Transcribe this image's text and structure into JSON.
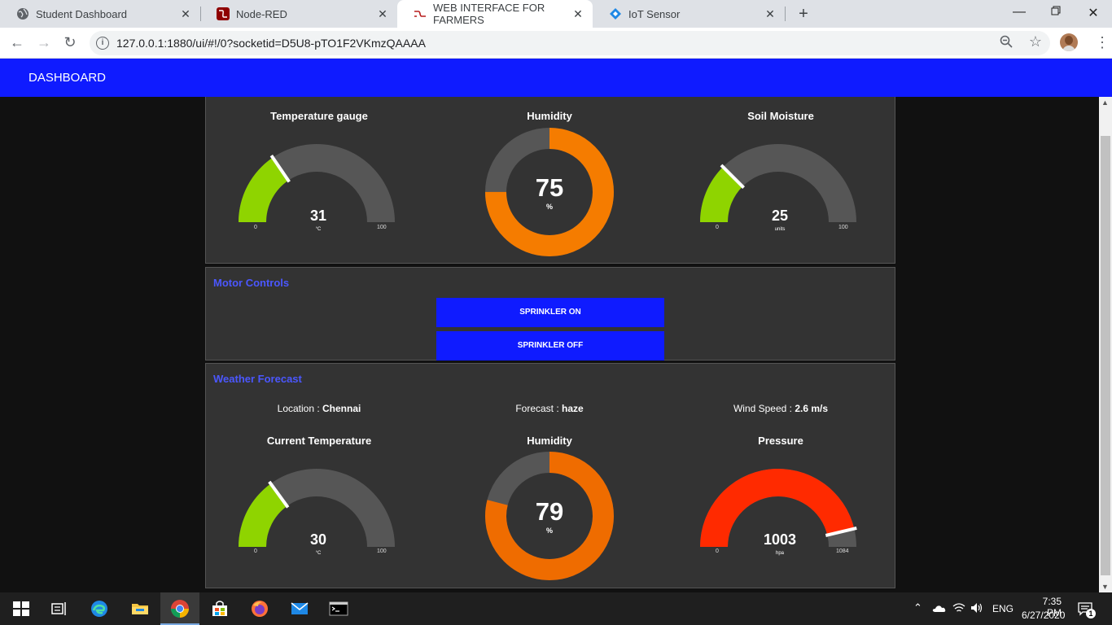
{
  "browser": {
    "tabs": [
      {
        "title": "Student Dashboard",
        "icon": "globe-icon"
      },
      {
        "title": "Node-RED",
        "icon": "node-red-icon"
      },
      {
        "title": "WEB INTERFACE FOR FARMERS",
        "icon": "node-red-ui-icon"
      },
      {
        "title": "IoT Sensor",
        "icon": "iot-sensor-icon"
      }
    ],
    "url": "127.0.0.1:1880/ui/#!/0?socketid=D5U8-pTO1F2VKmzQAAAA"
  },
  "dashboard": {
    "title": "DASHBOARD"
  },
  "sensors": {
    "temperature": {
      "title": "Temperature gauge",
      "value": "31",
      "unit": "°C",
      "min": "0",
      "max": "100",
      "level": 0.31,
      "color": "#8fd400"
    },
    "humidity": {
      "title": "Humidity",
      "value": "75",
      "unit": "%",
      "level": 0.75,
      "color": "#f57c00"
    },
    "soil": {
      "title": "Soil Moisture",
      "value": "25",
      "unit": "units",
      "min": "0",
      "max": "100",
      "level": 0.25,
      "color": "#8fd400"
    }
  },
  "motor": {
    "title": "Motor Controls",
    "on_label": "SPRINKLER ON",
    "off_label": "SPRINKLER OFF"
  },
  "weather": {
    "title": "Weather Forecast",
    "location_label": "Location : ",
    "location": "Chennai",
    "forecast_label": "Forecast : ",
    "forecast": "haze",
    "wind_label": "Wind Speed : ",
    "wind": "2.6 m/s",
    "current_temp": {
      "title": "Current Temperature",
      "value": "30",
      "unit": "°C",
      "min": "0",
      "max": "100",
      "level": 0.3,
      "color": "#8fd400"
    },
    "humidity": {
      "title": "Humidity",
      "value": "79",
      "unit": "%",
      "level": 0.79,
      "color": "#ef6c00"
    },
    "pressure": {
      "title": "Pressure",
      "value": "1003",
      "unit": "hpa",
      "min": "0",
      "max": "1084",
      "level": 0.925,
      "color": "#ff2a00"
    }
  },
  "taskbar": {
    "lang": "ENG",
    "time": "7:35 PM",
    "date": "6/27/2020",
    "notifications": "1"
  }
}
